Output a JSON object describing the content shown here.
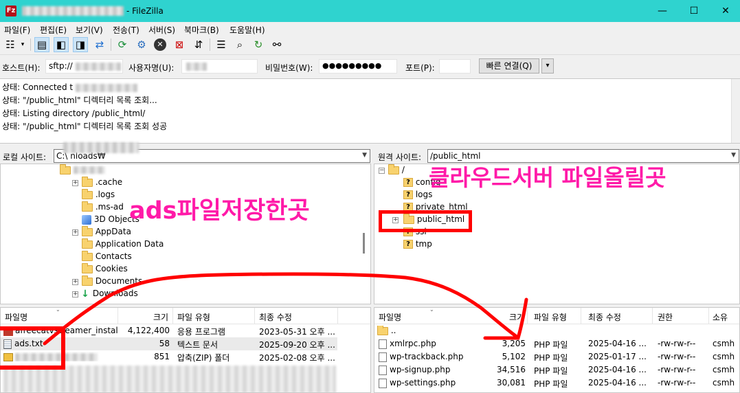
{
  "window": {
    "title": "- FileZilla",
    "app_icon_glyph": "Fz",
    "controls": {
      "minimize": "—",
      "maximize": "☐",
      "close": "✕"
    }
  },
  "menu": [
    "파일(F)",
    "편집(E)",
    "보기(V)",
    "전송(T)",
    "서버(S)",
    "북마크(B)",
    "도움말(H)"
  ],
  "quickconnect": {
    "host_label": "호스트(H):",
    "host_value": "sftp://",
    "user_label": "사용자명(U):",
    "pass_label": "비밀번호(W):",
    "pass_value": "●●●●●●●●●",
    "port_label": "포트(P):",
    "port_value": "",
    "connect_label": "빠른 연결(Q)",
    "dropdown": "▾"
  },
  "log": [
    "상태:\tConnected t",
    "상태:\t\"/public_html\" 디렉터리 목록 조회...",
    "상태:\tListing directory /public_html/",
    "상태:\t\"/public_html\" 디렉터리 목록 조회 성공"
  ],
  "local": {
    "site_label": "로컬 사이트:",
    "site_path": "C:\\                    nloads₩",
    "tree": [
      {
        "label": ".cache",
        "icon": "folder"
      },
      {
        "label": ".logs",
        "icon": "folder"
      },
      {
        "label": ".ms-ad",
        "icon": "folder"
      },
      {
        "label": "3D Objects",
        "icon": "cube"
      },
      {
        "label": "AppData",
        "icon": "folder"
      },
      {
        "label": "Application Data",
        "icon": "folder"
      },
      {
        "label": "Contacts",
        "icon": "folder"
      },
      {
        "label": "Cookies",
        "icon": "folder"
      },
      {
        "label": "Documents",
        "icon": "folder"
      },
      {
        "label": "Downloads",
        "icon": "download"
      }
    ],
    "columns": [
      "파일명",
      "크기",
      "파일 유형",
      "최종 수정"
    ],
    "files": [
      {
        "name": "afreecatvstreamer_installe...",
        "size": "4,122,400",
        "type": "응용 프로그램",
        "modified": "2023-05-31 오후 ..."
      },
      {
        "name": "ads.txt",
        "size": "58",
        "type": "텍스트 문서",
        "modified": "2025-09-20 오후 ..."
      },
      {
        "name": "",
        "size": "851",
        "type": "압축(ZIP) 폴더",
        "modified": "2025-02-08 오후 ..."
      }
    ]
  },
  "remote": {
    "site_label": "원격 사이트:",
    "site_path": "/public_html",
    "tree_root": "/",
    "tree": [
      {
        "label": "config",
        "icon": "qfolder"
      },
      {
        "label": "logs",
        "icon": "qfolder"
      },
      {
        "label": "private_html",
        "icon": "qfolder"
      },
      {
        "label": "public_html",
        "icon": "folder"
      },
      {
        "label": "ssl",
        "icon": "qfolder"
      },
      {
        "label": "tmp",
        "icon": "qfolder"
      }
    ],
    "columns": [
      "파일명",
      "크기",
      "파일 유형",
      "최종 수정",
      "권한",
      "소유"
    ],
    "parent_dir": "..",
    "files": [
      {
        "name": "xmlrpc.php",
        "size": "3,205",
        "type": "PHP 파일",
        "modified": "2025-04-16 ...",
        "perms": "-rw-rw-r--",
        "owner": "csmh"
      },
      {
        "name": "wp-trackback.php",
        "size": "5,102",
        "type": "PHP 파일",
        "modified": "2025-01-17 ...",
        "perms": "-rw-rw-r--",
        "owner": "csmh"
      },
      {
        "name": "wp-signup.php",
        "size": "34,516",
        "type": "PHP 파일",
        "modified": "2025-04-16 ...",
        "perms": "-rw-rw-r--",
        "owner": "csmh"
      },
      {
        "name": "wp-settings.php",
        "size": "30,081",
        "type": "PHP 파일",
        "modified": "2025-04-16 ...",
        "perms": "-rw-rw-r--",
        "owner": "csmh"
      }
    ]
  },
  "annotations": {
    "local_note": "ads파일저장한곳",
    "remote_note": "클라우드서버 파일올릴곳",
    "color": "#ff1aa8",
    "box_color": "#ff0000"
  }
}
